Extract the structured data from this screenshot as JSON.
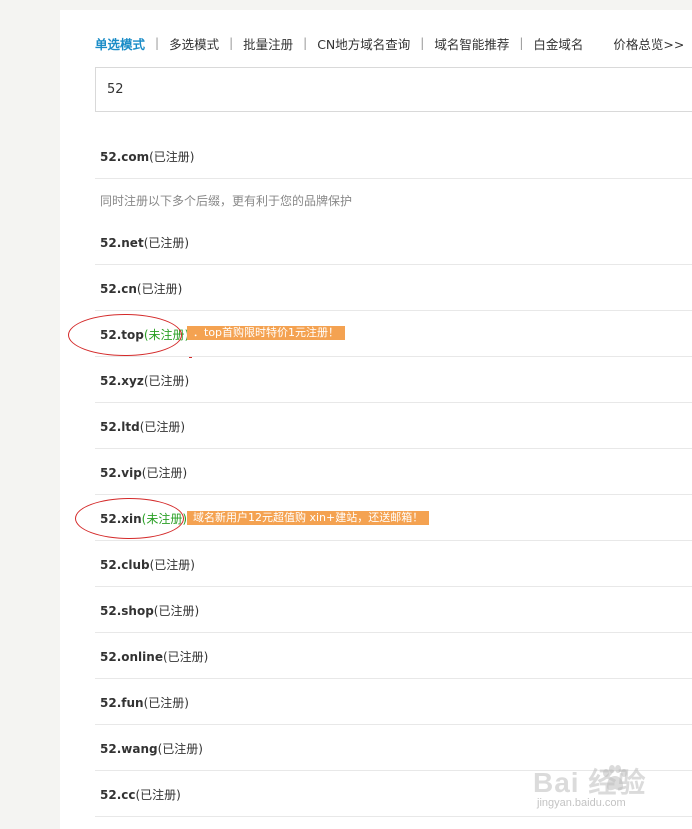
{
  "tabs": {
    "single": "单选模式",
    "multi": "多选模式",
    "batch": "批量注册",
    "cn_local": "CN地方域名查询",
    "smart": "域名智能推荐",
    "platinum": "白金域名",
    "price": "价格总览>>",
    "separator": "|"
  },
  "search": {
    "value": "52"
  },
  "note": "同时注册以下多个后缀，更有利于您的品牌保护",
  "results": [
    {
      "domain": "52.com",
      "status": "(已注册)",
      "available": false
    },
    {
      "domain": "52.net",
      "status": "(已注册)",
      "available": false
    },
    {
      "domain": "52.cn",
      "status": "(已注册)",
      "available": false
    },
    {
      "domain": "52.top",
      "status": "(未注册)",
      "available": true,
      "promo": "．top首购限时特价1元注册！"
    },
    {
      "domain": "52.xyz",
      "status": "(已注册)",
      "available": false
    },
    {
      "domain": "52.ltd",
      "status": "(已注册)",
      "available": false
    },
    {
      "domain": "52.vip",
      "status": "(已注册)",
      "available": false
    },
    {
      "domain": "52.xin",
      "status": "(未注册)",
      "available": true,
      "promo": "域名新用户12元超值购 xin+建站，还送邮箱！"
    },
    {
      "domain": "52.club",
      "status": "(已注册)",
      "available": false
    },
    {
      "domain": "52.shop",
      "status": "(已注册)",
      "available": false
    },
    {
      "domain": "52.online",
      "status": "(已注册)",
      "available": false
    },
    {
      "domain": "52.fun",
      "status": "(已注册)",
      "available": false
    },
    {
      "domain": "52.wang",
      "status": "(已注册)",
      "available": false
    },
    {
      "domain": "52.cc",
      "status": "(已注册)",
      "available": false
    }
  ],
  "watermark": {
    "logo": "Bai  经验",
    "url": "jingyan.baidu.com"
  },
  "colors": {
    "accent": "#1a8cc7",
    "available": "#2aa025",
    "promo_bg": "#f4a251",
    "annotation": "#d42a2a"
  }
}
